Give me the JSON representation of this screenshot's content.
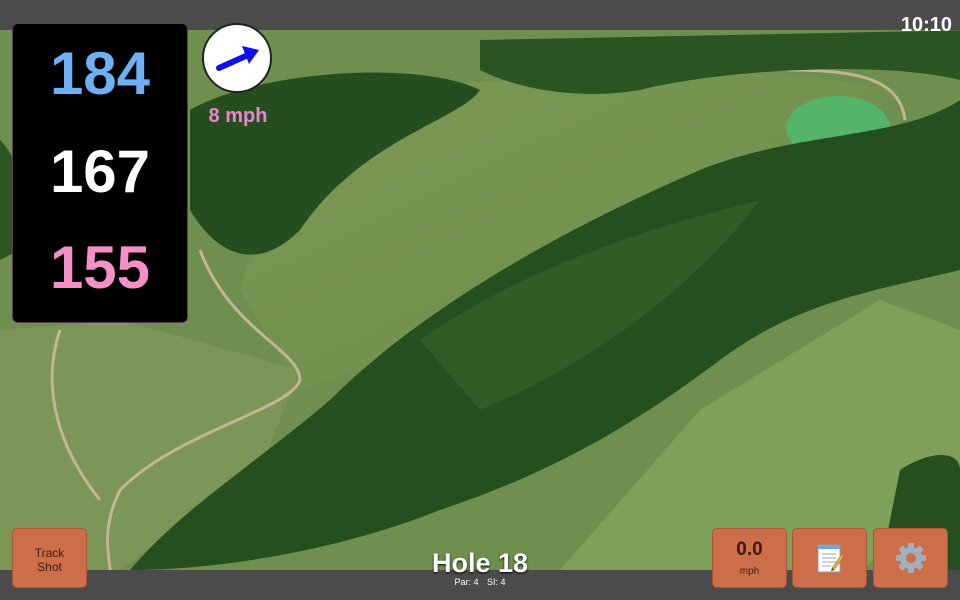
{
  "status_bar": {
    "time": "10:10"
  },
  "distances": {
    "back": "184",
    "middle": "167",
    "front": "155",
    "colors": {
      "back": "#6fb0f5",
      "middle": "#ffffff",
      "front": "#f48fc8"
    }
  },
  "wind": {
    "speed": "8 mph",
    "icon": "wind-arrow-icon",
    "color": "#e986cf",
    "arrow_color": "#1010ee"
  },
  "hole": {
    "title": "Hole 18",
    "par": "Par: 4",
    "si": "SI: 4"
  },
  "buttons": {
    "track_shot": "Track Shot",
    "speed_value": "0.0",
    "speed_unit": "mph",
    "notes_icon": "notepad-icon",
    "settings_icon": "gear-icon",
    "accent": "#cd6e49"
  }
}
